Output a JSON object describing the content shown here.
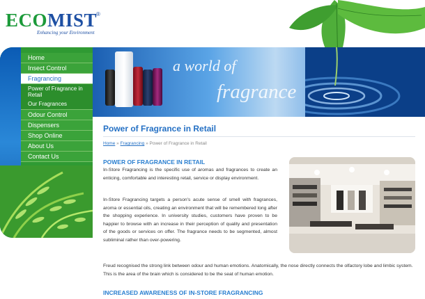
{
  "logo": {
    "brand_eco": "ECO",
    "brand_mist": "MIST",
    "registered": "®",
    "tagline": "Enhancing your Environment"
  },
  "banner": {
    "line1": "a world of",
    "line2": "fragrance"
  },
  "nav": {
    "items": [
      {
        "label": "Home"
      },
      {
        "label": "Insect Control"
      },
      {
        "label": "Fragrancing"
      },
      {
        "label": "Power of Fragrance in Retail"
      },
      {
        "label": "Our Fragrances"
      },
      {
        "label": "Odour Control"
      },
      {
        "label": "Dispensers"
      },
      {
        "label": "Shop Online"
      },
      {
        "label": "About Us"
      },
      {
        "label": "Contact Us"
      }
    ]
  },
  "page": {
    "title": "Power of Fragrance in Retail",
    "breadcrumb": {
      "home": "Home",
      "sep1": " » ",
      "fragrancing": "Fragrancing",
      "sep2": " » ",
      "current": "Power of Fragrance in Retail"
    },
    "section1_heading": "POWER OF FRAGRANCE IN RETAIL",
    "para1": "In-Store Fragrancing is the specific use of aromas and fragrances to create an enticing, comfortable and interesting retail, service or display environment.",
    "para2": "In-Store Fragrancing targets a person's acute sense of smell with fragrances, aroma or essential oils, creating an environment that will be remembered long after the shopping experience. In university studies, customers have proven to be happier to browse with an increase in their perception of quality and presentation of the goods or services on offer. The fragrance needs to be segmented, almost subliminal rather than over-powering.",
    "para3": "Freud recognised the strong link between odour and human emotions. Anatomically, the nose directly connects the olfactory lobe and limbic system. This is the area of the brain which is considered to be the seat of human emotion.",
    "section2_heading": "INCREASED AWARENESS OF IN-STORE FRAGRANCING"
  },
  "colors": {
    "green": "#2f9a33",
    "blue": "#1a6ac6",
    "link": "#2470c4"
  }
}
